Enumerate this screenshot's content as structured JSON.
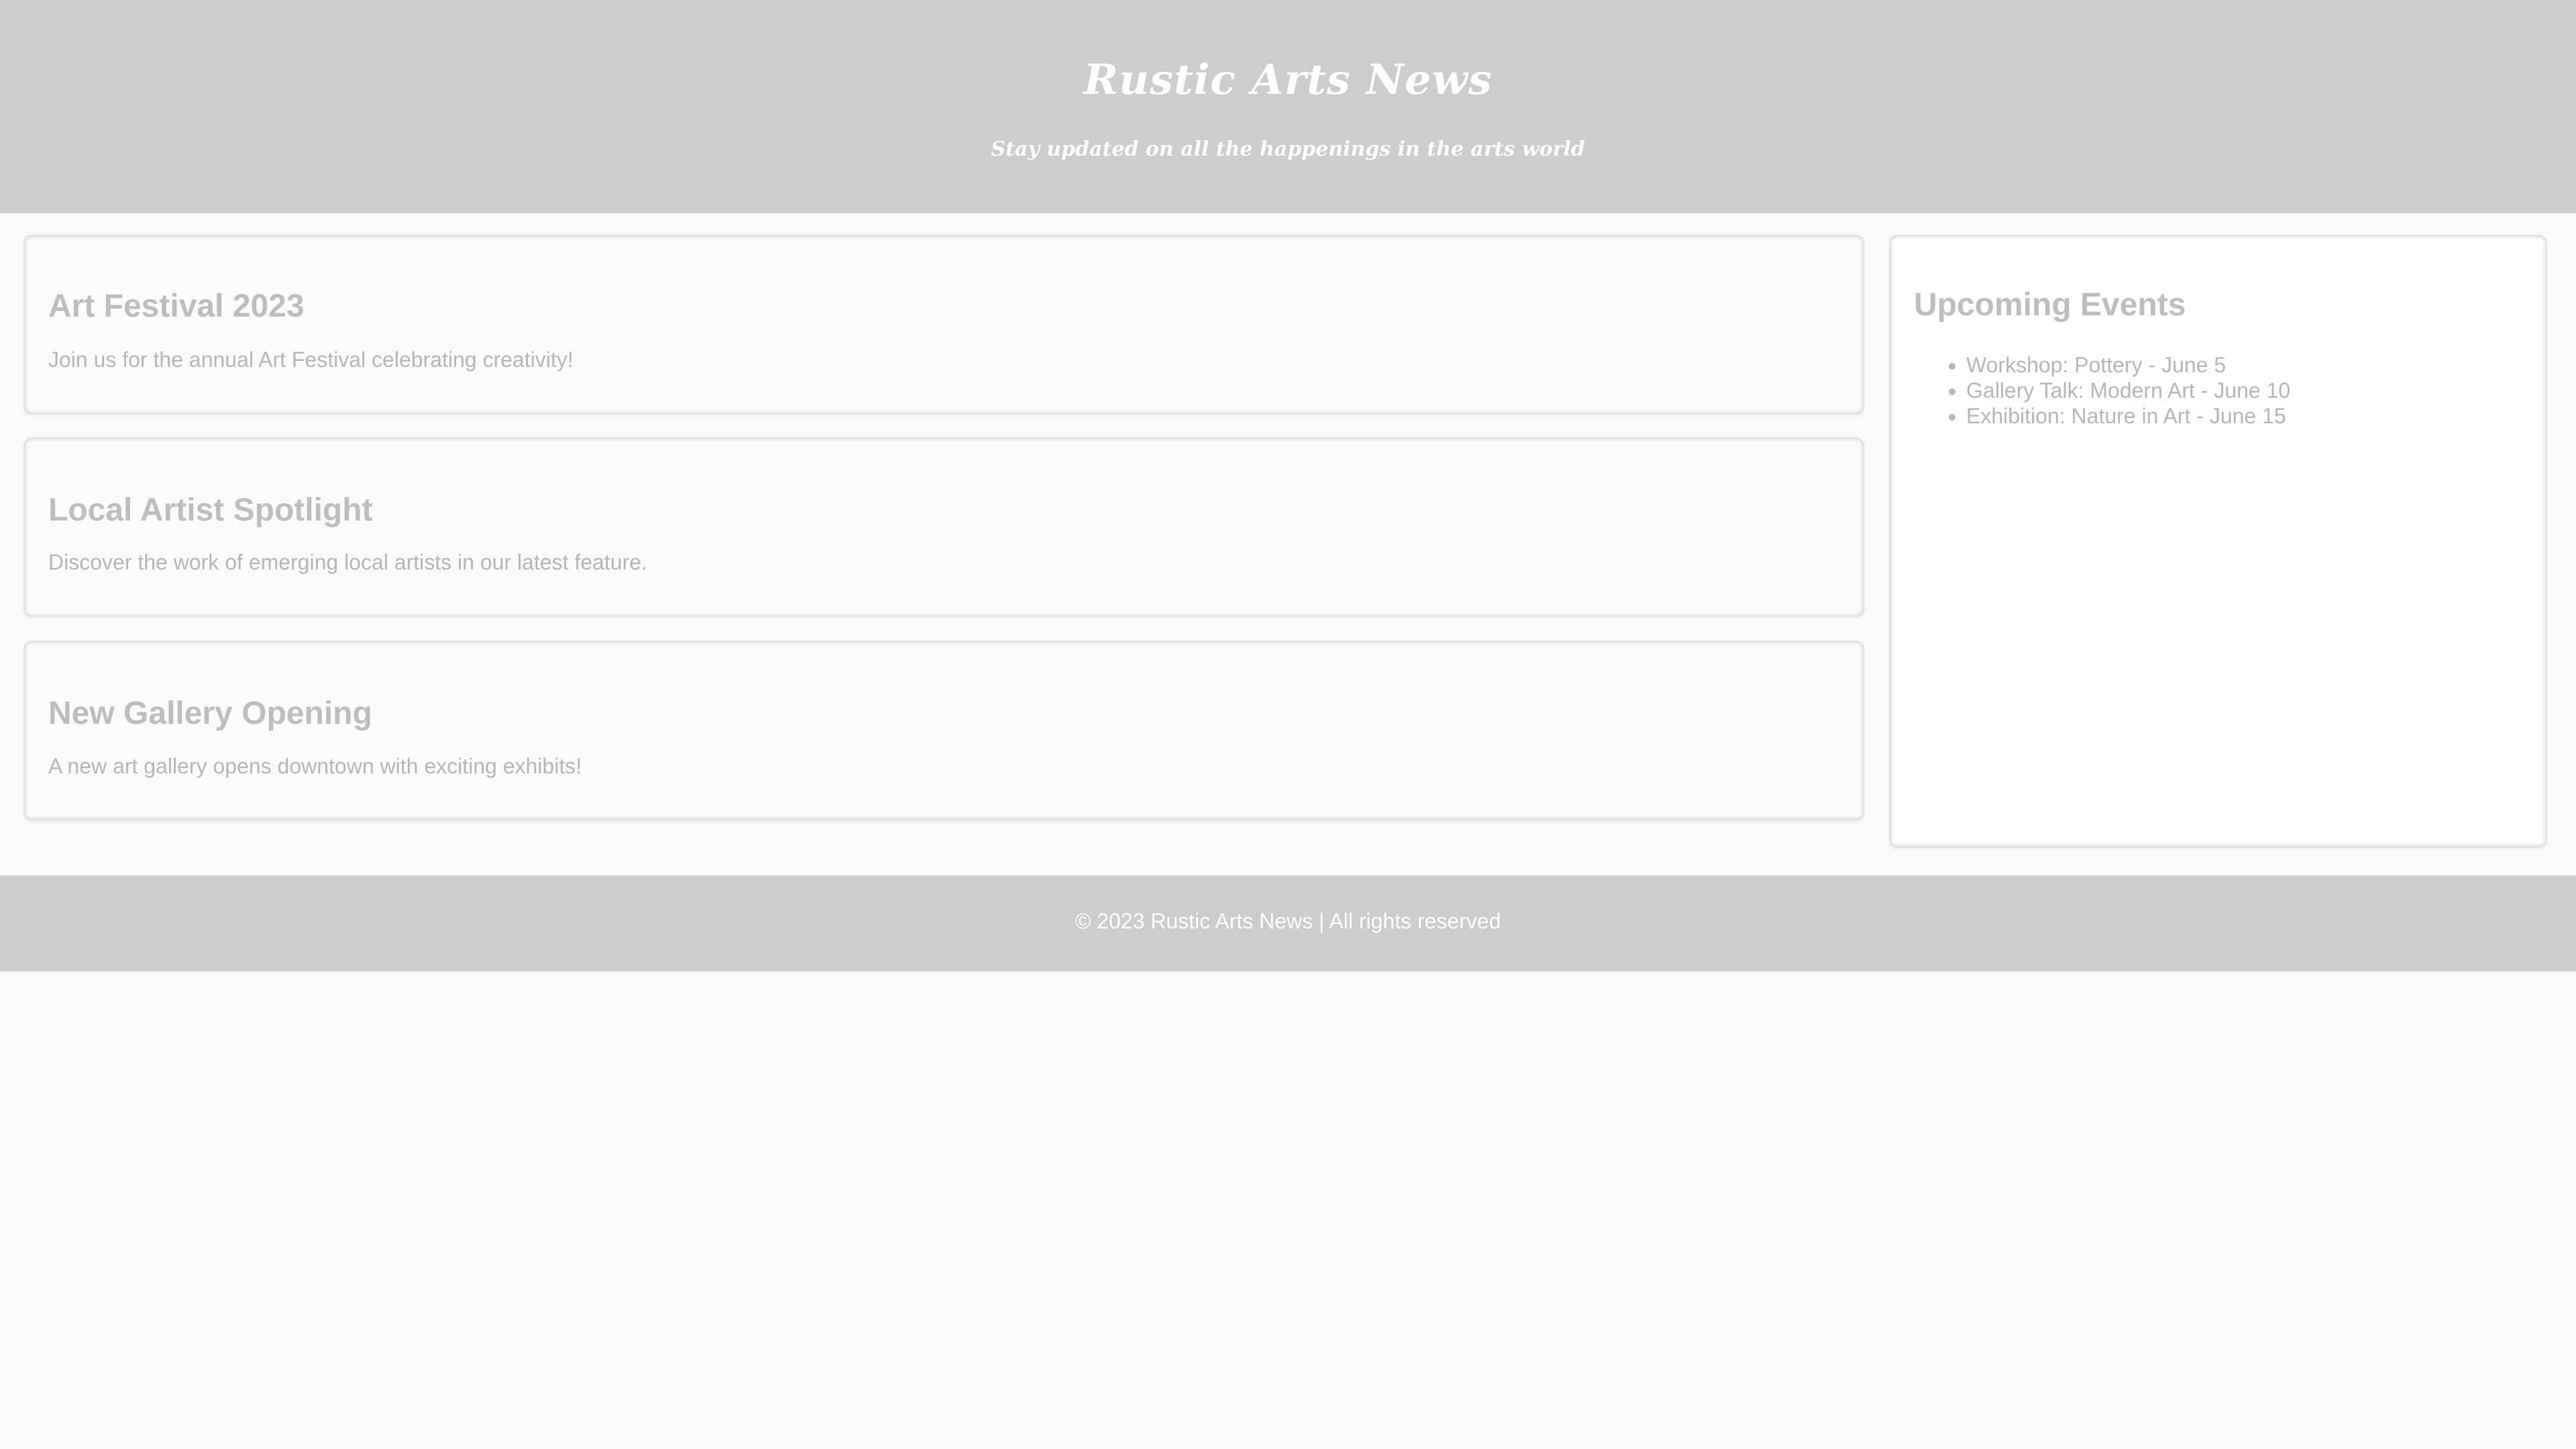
{
  "header": {
    "title": "Rustic Arts News",
    "tagline": "Stay updated on all the happenings in the arts world"
  },
  "articles": [
    {
      "title": "Art Festival 2023",
      "summary": "Join us for the annual Art Festival celebrating creativity!"
    },
    {
      "title": "Local Artist Spotlight",
      "summary": "Discover the work of emerging local artists in our latest feature."
    },
    {
      "title": "New Gallery Opening",
      "summary": "A new art gallery opens downtown with exciting exhibits!"
    }
  ],
  "sidebar": {
    "title": "Upcoming Events",
    "events": [
      "Workshop: Pottery - June 5",
      "Gallery Talk: Modern Art - June 10",
      "Exhibition: Nature in Art - June 15"
    ]
  },
  "footer": {
    "text": "© 2023 Rustic Arts News | All rights reserved"
  },
  "colors": {
    "header_footer_bg": "#cccccc",
    "page_bg": "#fafafa",
    "heading_text": "#bdbdbd",
    "body_text": "#b5b5b5"
  }
}
